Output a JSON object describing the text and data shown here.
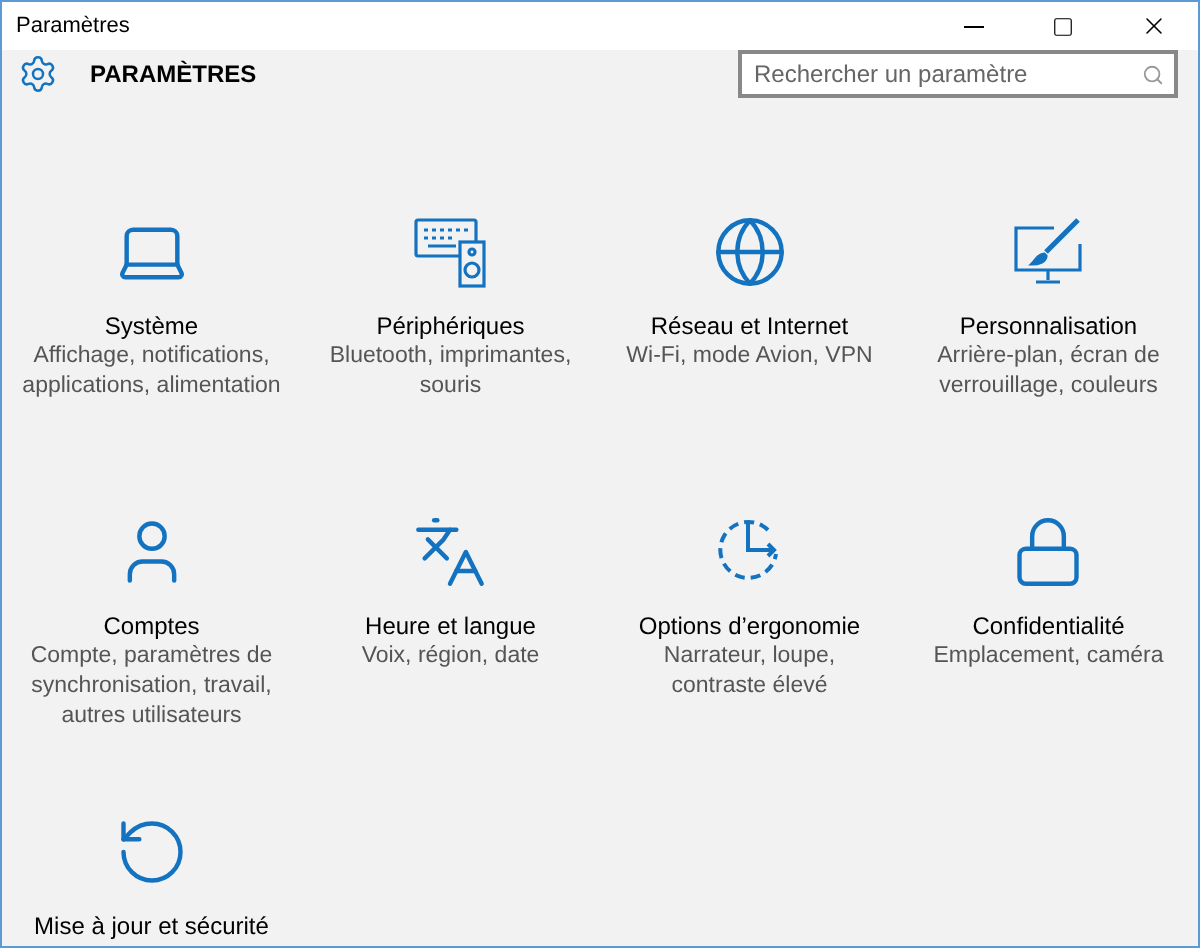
{
  "window": {
    "title": "Paramètres"
  },
  "header": {
    "title": "PARAMÈTRES",
    "search": {
      "placeholder": "Rechercher un paramètre"
    }
  },
  "categories": [
    {
      "kind": "laptop",
      "title": "Système",
      "subtitle": "Affichage, notifications, applications, alimentation"
    },
    {
      "kind": "devices",
      "title": "Périphériques",
      "subtitle": "Bluetooth, imprimantes, souris"
    },
    {
      "kind": "globe",
      "title": "Réseau et Internet",
      "subtitle": "Wi-Fi, mode Avion, VPN"
    },
    {
      "kind": "paint",
      "title": "Personnalisation",
      "subtitle": "Arrière-plan, écran de verrouillage, couleurs"
    },
    {
      "kind": "person",
      "title": "Comptes",
      "subtitle": "Compte, paramètres de synchronisation, travail, autres utilisateurs"
    },
    {
      "kind": "language",
      "title": "Heure et langue",
      "subtitle": "Voix, région, date"
    },
    {
      "kind": "ease",
      "title": "Options d’ergonomie",
      "subtitle": "Narrateur, loupe, contraste élevé"
    },
    {
      "kind": "lock",
      "title": "Confidentialité",
      "subtitle": "Emplacement, caméra"
    },
    {
      "kind": "update",
      "title": "Mise à jour et sécurité"
    }
  ]
}
